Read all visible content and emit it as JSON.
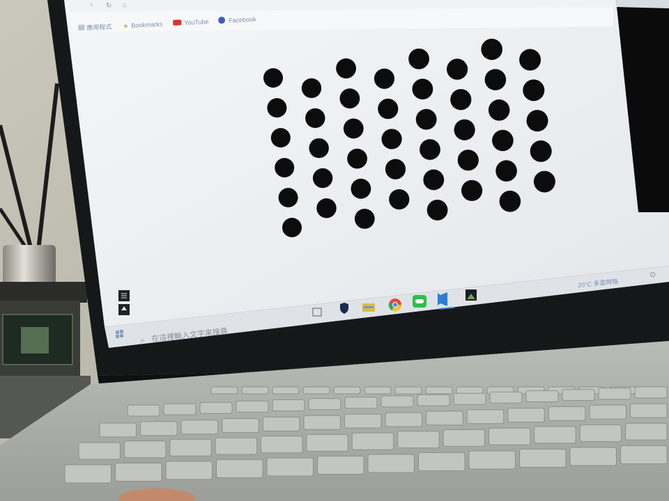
{
  "browser": {
    "bookmarks": [
      {
        "label": "應用程式",
        "icon": "apps-grid-icon"
      },
      {
        "label": "Bookmarks",
        "icon": "star-icon"
      },
      {
        "label": "YouTube",
        "icon": "youtube-icon"
      },
      {
        "label": "Facebook",
        "icon": "facebook-icon"
      }
    ]
  },
  "pattern": {
    "name": "asymmetric-circle-grid",
    "rows": 11,
    "cols": 4,
    "dot_color": "#0c0c0d"
  },
  "taskbar": {
    "search_placeholder": "在這裡輸入文字來搜尋",
    "apps": [
      "task-view-icon",
      "shield-icon",
      "file-explorer-icon",
      "chrome-icon",
      "line-icon",
      "vscode-icon",
      "image-app-icon"
    ],
    "weather": "20°C 多雲時陰"
  },
  "colors": {
    "screen_bg": "#eef0f2",
    "bezel": "#141516",
    "taskbar": "#dfe3e8",
    "keyboard_deck": "#a8aaa6",
    "key": "#c3c5c1"
  }
}
